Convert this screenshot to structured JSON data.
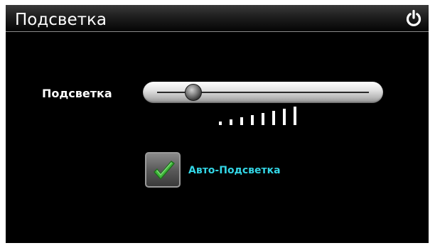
{
  "header": {
    "title": "Подсветка",
    "power_icon": "power-icon"
  },
  "backlight": {
    "label": "Подсветка",
    "slider_level": 0.17,
    "level_bar_count": 8
  },
  "auto_backlight": {
    "label": "Авто-Подсветка",
    "checked": true,
    "check_icon": "checkmark-icon"
  },
  "colors": {
    "background": "#000000",
    "accent_label": "#33d6e6",
    "check_green": "#3fb83a"
  }
}
